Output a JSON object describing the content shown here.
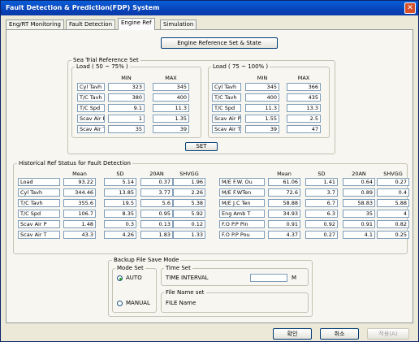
{
  "window": {
    "title": "Fault Detection & Prediction(FDP) System"
  },
  "tabs": [
    "Eng/RT Monitoring",
    "Fault Detection",
    "Engine Ref",
    "Simulation"
  ],
  "active_tab": "Engine Ref",
  "engine_ref_button": "Engine Reference Set & State",
  "ref_set": {
    "group_title": "Sea Trial Reference Set",
    "low": {
      "title": "Load ( 50 ~ 75% )",
      "min_label": "MIN",
      "max_label": "MAX",
      "rows": [
        {
          "label": "Cyl Tavh",
          "min": "323",
          "max": "345"
        },
        {
          "label": "T/C Tavh",
          "min": "380",
          "max": "400"
        },
        {
          "label": "T/C Spd",
          "min": "9.1",
          "max": "11.3"
        },
        {
          "label": "Scav Air P",
          "min": "1",
          "max": "1.35"
        },
        {
          "label": "Scav Air T",
          "min": "35",
          "max": "39"
        }
      ]
    },
    "high": {
      "title": "Load ( 75 ~ 100% )",
      "min_label": "MIN",
      "max_label": "MAX",
      "rows": [
        {
          "label": "Cyl Tavh",
          "min": "345",
          "max": "366"
        },
        {
          "label": "T/C Tavh",
          "min": "400",
          "max": "435"
        },
        {
          "label": "T/C Spd",
          "min": "11.3",
          "max": "13.3"
        },
        {
          "label": "Scav Air P",
          "min": "1.55",
          "max": "2.5"
        },
        {
          "label": "Scav Air T",
          "min": "39",
          "max": "47"
        }
      ]
    },
    "set_button": "SET"
  },
  "historical": {
    "title": "Historical Ref Status for Fault Detection",
    "headers": [
      "Mean",
      "SD",
      "20AN",
      "SHVGG"
    ],
    "left_rows": [
      {
        "label": "Load",
        "v": [
          "93.22",
          "5.14",
          "0.37",
          "1.96"
        ]
      },
      {
        "label": "Cyl Tavh",
        "v": [
          "344.46",
          "13.85",
          "3.77",
          "2.26"
        ]
      },
      {
        "label": "T/C Tavh",
        "v": [
          "355.6",
          "19.5",
          "5.6",
          "5.38"
        ]
      },
      {
        "label": "T/C Spd",
        "v": [
          "106.7",
          "8.35",
          "0.95",
          "5.92"
        ]
      },
      {
        "label": "Scav Air P",
        "v": [
          "1.48",
          "0.3",
          "0.13",
          "0.12"
        ]
      },
      {
        "label": "Scav Air T",
        "v": [
          "43.3",
          "4.26",
          "1.83",
          "1.33"
        ]
      }
    ],
    "right_rows": [
      {
        "label": "M/E F.W. Ou",
        "v": [
          "61.06",
          "1.41",
          "0.64",
          "0.27"
        ]
      },
      {
        "label": "M/E F.WTen",
        "v": [
          "72.6",
          "3.7",
          "0.89",
          "0.4"
        ]
      },
      {
        "label": "M/E J.C Ten",
        "v": [
          "58.88",
          "6.7",
          "58.83",
          "5.88"
        ]
      },
      {
        "label": "Eng Amb T",
        "v": [
          "34.93",
          "6.3",
          "35",
          "4"
        ]
      },
      {
        "label": "F.O P.P Pin",
        "v": [
          "0.91",
          "0.92",
          "0.91",
          "0.82"
        ]
      },
      {
        "label": "F.O P.P Pou",
        "v": [
          "4.37",
          "0.27",
          "4.1",
          "0.25"
        ]
      }
    ]
  },
  "backup": {
    "title": "Backup File Save Mode",
    "mode_title": "Mode Set",
    "auto": "AUTO",
    "manual": "MANUAL",
    "time_title": "Time Set",
    "time_interval": "TIME INTERVAL",
    "time_value": "",
    "unit": "M",
    "file_title": "File Name set",
    "file_name": "FILE Name"
  },
  "footer": {
    "ok": "확인",
    "cancel": "취소",
    "apply": "적용(A)"
  }
}
